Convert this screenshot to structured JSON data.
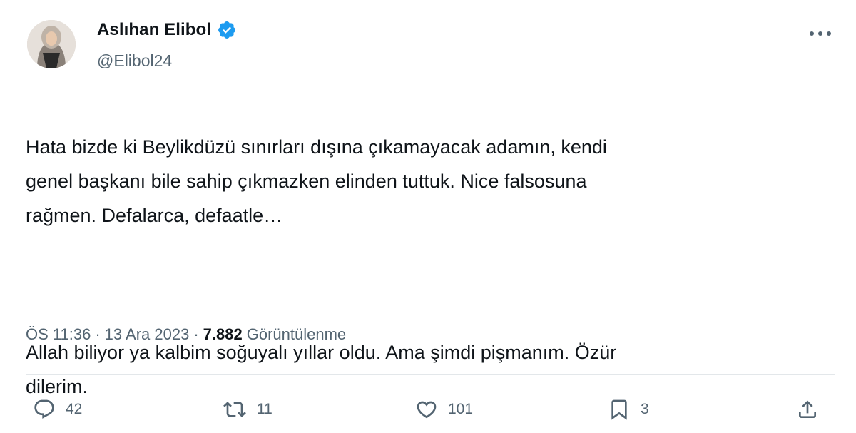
{
  "author": {
    "display_name": "Aslıhan Elibol",
    "handle": "@Elibol24",
    "verified": true,
    "avatar_icon": "profile-photo"
  },
  "menu": {
    "icon": "more-horizontal-icon"
  },
  "tweet": {
    "paragraphs": [
      "Hata bizde ki Beylikdüzü sınırları dışına çıkamayacak adamın, kendi\ngenel başkanı bile sahip çıkmazken elinden tuttuk. Nice falsosuna\nrağmen. Defalarca, defaatle…",
      "Allah biliyor ya kalbim soğuyalı yıllar oldu. Ama şimdi pişmanım. Özür\ndilerim."
    ]
  },
  "meta": {
    "time": "ÖS 11:36",
    "separator": "·",
    "date": "13 Ara 2023",
    "views_count": "7.882",
    "views_label": "Görüntülenme"
  },
  "actions": {
    "reply": {
      "icon": "reply-icon",
      "count": "42"
    },
    "retweet": {
      "icon": "retweet-icon",
      "count": "11"
    },
    "like": {
      "icon": "heart-icon",
      "count": "101"
    },
    "bookmark": {
      "icon": "bookmark-icon",
      "count": "3"
    },
    "share": {
      "icon": "share-icon"
    }
  },
  "colors": {
    "text_primary": "#0f1419",
    "text_secondary": "#536471",
    "verified_blue": "#1d9bf0",
    "divider": "#e3e7ea"
  }
}
